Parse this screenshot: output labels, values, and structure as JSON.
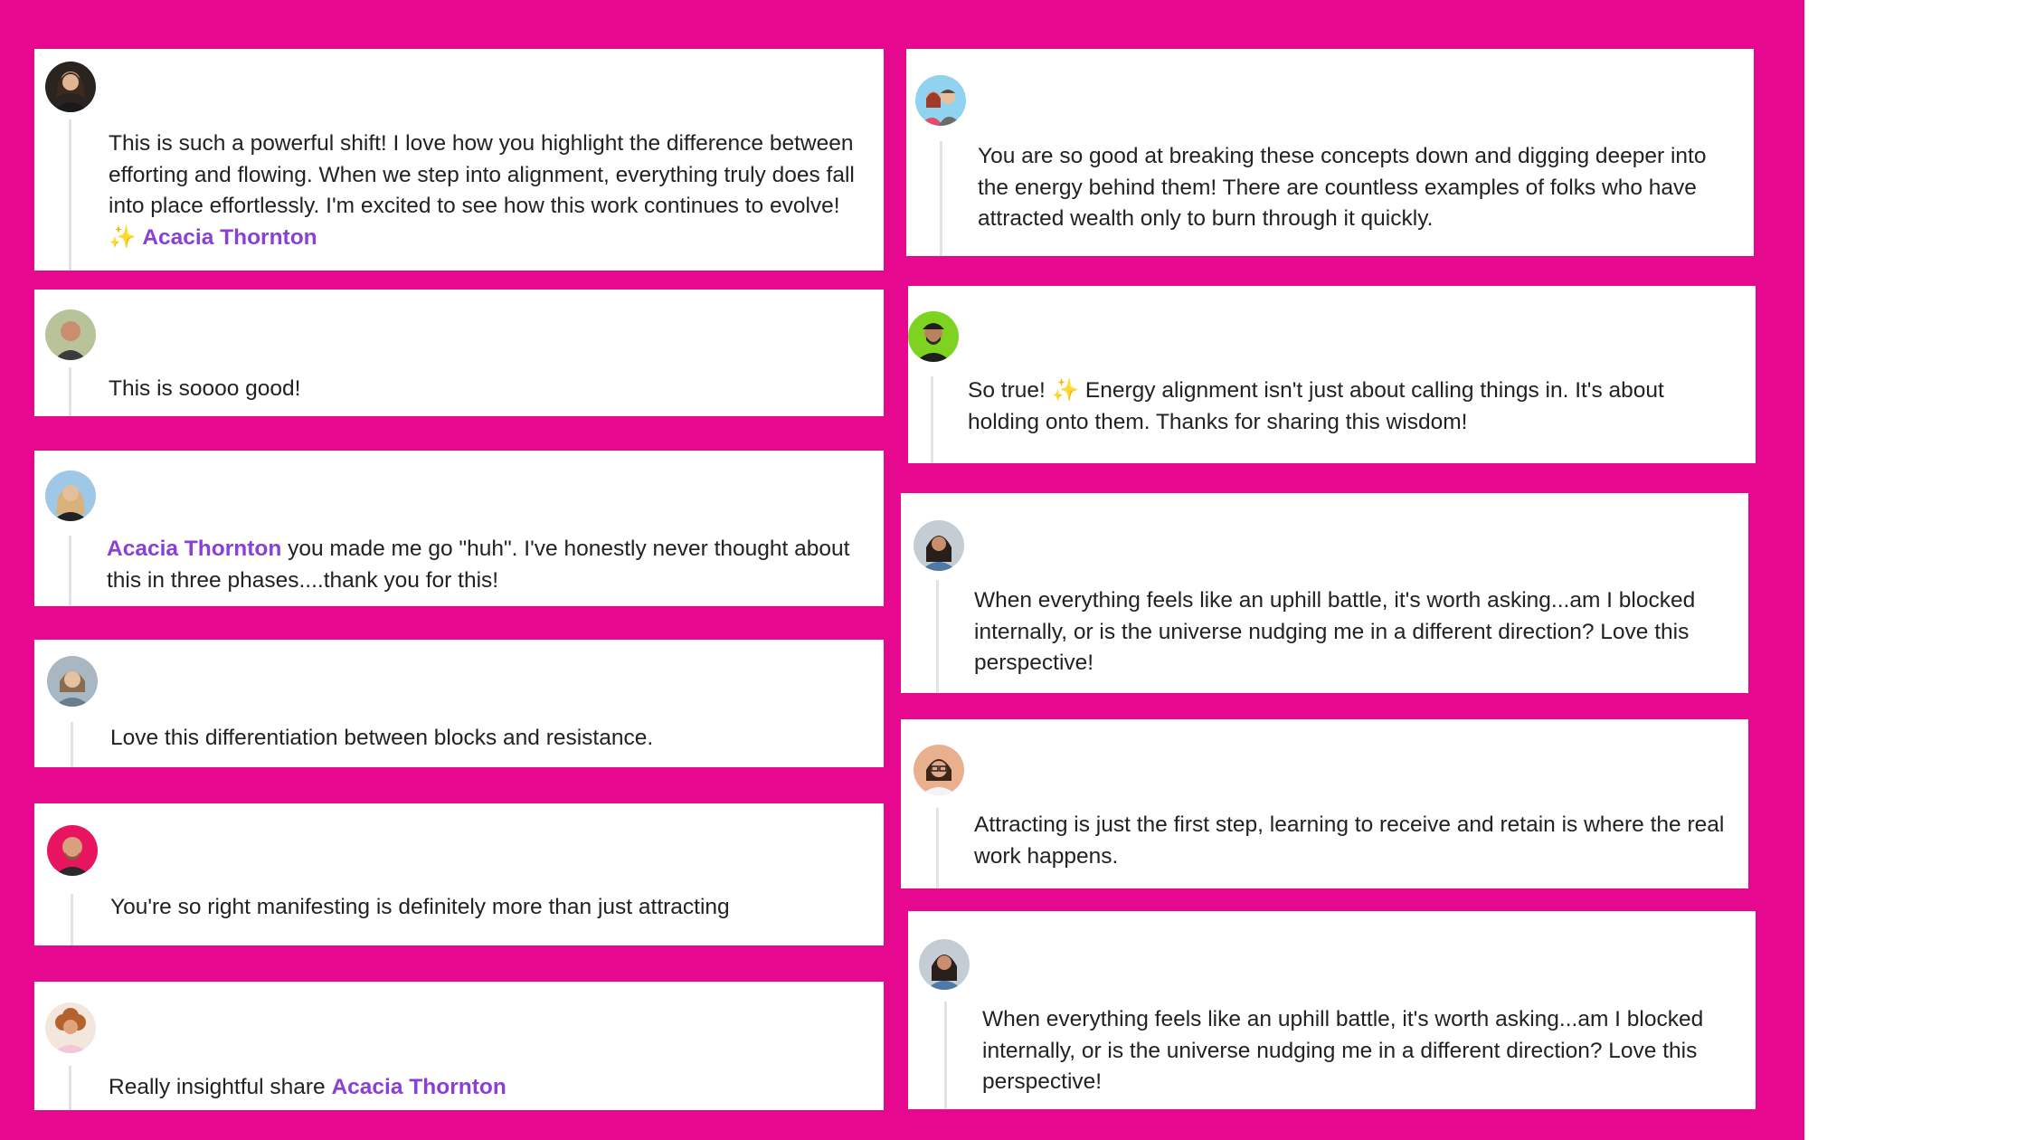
{
  "mention_color": "#8a3fd6",
  "background_color": "#e6088e",
  "comments": [
    {
      "avatar_icon": "avatar-woman-dark-hair-icon",
      "text_1": "This is such a powerful shift! I love how you highlight the difference between efforting and flowing. When we step into alignment, everything truly does fall into place effortlessly. I'm excited to see how this work continues to evolve! ",
      "emoji": "✨",
      "mention": "Acacia Thornton"
    },
    {
      "avatar_icon": "avatar-man-bald-icon",
      "text_1": "This is soooo good!"
    },
    {
      "avatar_icon": "avatar-woman-blonde-icon",
      "mention": "Acacia Thornton",
      "text_2": " you made me go \"huh\". I've honestly never thought about this in three phases....thank you for this!"
    },
    {
      "avatar_icon": "avatar-woman-short-hair-icon",
      "text_1": "Love this differentiation between blocks and resistance."
    },
    {
      "avatar_icon": "avatar-man-pink-background-icon",
      "text_1": "You're so right manifesting is definitely more than just attracting"
    },
    {
      "avatar_icon": "avatar-woman-curly-hair-icon",
      "text_1": "Really insightful share ",
      "mention": "Acacia Thornton"
    },
    {
      "avatar_icon": "avatar-couple-icon",
      "text_1": "You are so good at breaking these concepts down and digging deeper into the energy behind them! There are countless examples of folks who have attracted wealth only to burn through it quickly."
    },
    {
      "avatar_icon": "avatar-man-green-background-icon",
      "text_1": "So true! ",
      "emoji": "✨",
      "text_2": " Energy alignment isn't just about calling things in. It's about holding onto them. Thanks for sharing this wisdom!"
    },
    {
      "avatar_icon": "avatar-woman-denim-icon",
      "text_1": "When everything feels like an uphill battle, it's worth asking...am I blocked internally, or is the universe nudging me in a different direction? Love this perspective!"
    },
    {
      "avatar_icon": "avatar-woman-glasses-icon",
      "text_1": "Attracting is just the first step, learning to receive and retain is where the real work happens."
    },
    {
      "avatar_icon": "avatar-woman-denim-icon",
      "text_1": "When everything feels like an uphill battle, it's worth asking...am I blocked internally, or is the universe nudging me in a different direction? Love this perspective!"
    }
  ]
}
